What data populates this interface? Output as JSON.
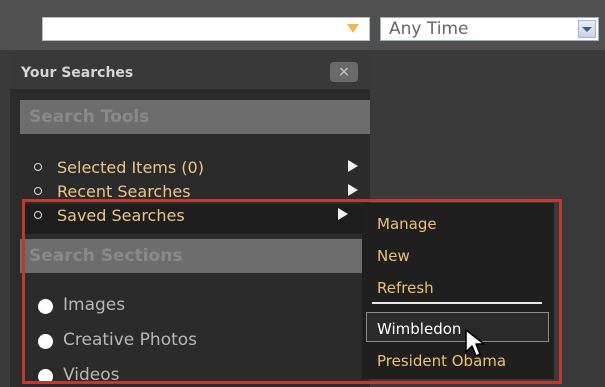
{
  "search": {
    "query_value": "",
    "time_filter": "Any Time"
  },
  "panel": {
    "title": "Your Searches",
    "close_label": "×",
    "search_tools_heading": "Search Tools",
    "tools": [
      {
        "label": "Selected Items (0)"
      },
      {
        "label": "Recent Searches"
      },
      {
        "label": "Saved Searches"
      }
    ],
    "search_sections_heading": "Search Sections",
    "sections": [
      {
        "label": "Images"
      },
      {
        "label": "Creative Photos"
      },
      {
        "label": "Videos"
      }
    ]
  },
  "saved_menu": {
    "actions": [
      {
        "label": "Manage"
      },
      {
        "label": "New"
      },
      {
        "label": "Refresh"
      }
    ],
    "saved_items": [
      {
        "label": "Wimbledon"
      },
      {
        "label": "President Obama"
      }
    ]
  },
  "colors": {
    "accent": "#f0c070",
    "highlight_frame": "#c0392b"
  }
}
